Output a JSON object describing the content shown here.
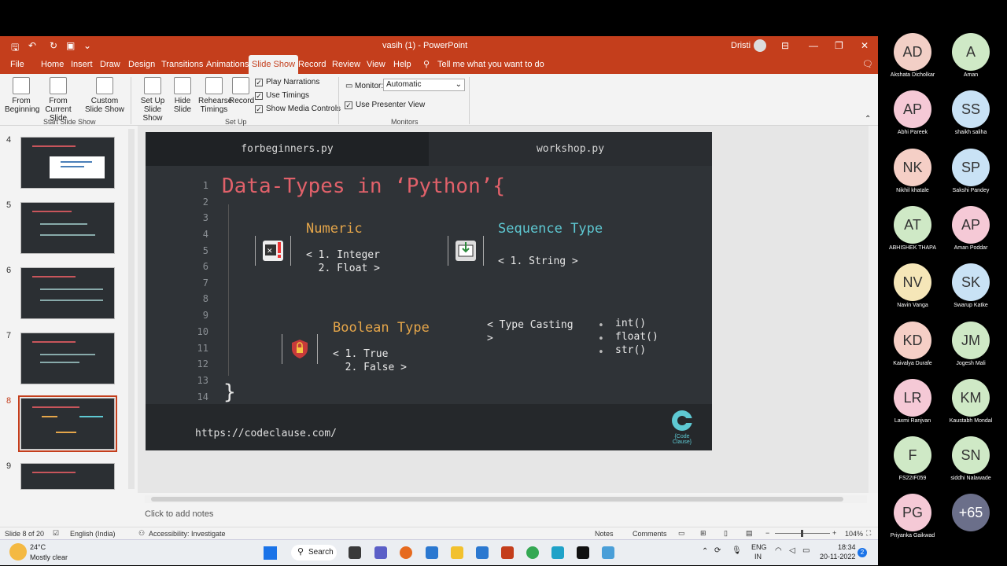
{
  "window": {
    "title": "vasih (1) - PowerPoint",
    "user": "Dristi"
  },
  "menu": [
    "File",
    "Home",
    "Insert",
    "Draw",
    "Design",
    "Transitions",
    "Animations",
    "Slide Show",
    "Record",
    "Review",
    "View",
    "Help",
    "Tell me what you want to do"
  ],
  "ribbon": {
    "from_beginning": "From Beginning",
    "from_current": "From Current Slide",
    "custom_show": "Custom Slide Show",
    "group_start": "Start Slide Show",
    "setup_show": "Set Up Slide Show",
    "hide_slide": "Hide Slide",
    "rehearse": "Rehearse Timings",
    "record": "Record",
    "play_narrations": "Play Narrations",
    "use_timings": "Use Timings",
    "show_media": "Show Media Controls",
    "group_setup": "Set Up",
    "monitor_label": "Monitor:",
    "monitor_value": "Automatic",
    "presenter_view": "Use Presenter View",
    "group_monitors": "Monitors"
  },
  "thumbs": [
    "4",
    "5",
    "6",
    "7",
    "8",
    "9"
  ],
  "slide": {
    "tab_left": "forbeginners.py",
    "tab_right": "workshop.py",
    "title": "Data-Types in ‘Python’{",
    "line_numbers": [
      "1",
      "2",
      "3",
      "4",
      "5",
      "6",
      "7",
      "8",
      "9",
      "10",
      "11",
      "12",
      "13",
      "14"
    ],
    "numeric_heading": "Numeric",
    "numeric_items": "< 1. Integer\n  2. Float >",
    "sequence_heading": "Sequence Type",
    "sequence_items": "< 1. String >",
    "boolean_heading": "Boolean Type",
    "boolean_items": "< 1. True\n  2. False >",
    "casting": "< Type Casting\n>",
    "casting_funcs": "int()\nfloat()\nstr()",
    "close_brace": "}",
    "url": "https://codeclause.com/",
    "logo_text": "{Code Clause}"
  },
  "notes_placeholder": "Click to add notes",
  "status": {
    "slide": "Slide 8 of 20",
    "language": "English (India)",
    "accessibility": "Accessibility: Investigate",
    "notes": "Notes",
    "comments": "Comments",
    "zoom": "104%"
  },
  "taskbar": {
    "temp": "24°C",
    "weather": "Mostly clear",
    "search": "Search",
    "lang1": "ENG",
    "lang2": "IN",
    "time": "18:34",
    "date": "20-11-2022",
    "badge": "2"
  },
  "participants": [
    {
      "initials": "AD",
      "name": "Akshata Dicholkar",
      "color": "#f2cfc6"
    },
    {
      "initials": "A",
      "name": "Aman",
      "color": "#cfe9c6"
    },
    {
      "initials": "AP",
      "name": "Abhi Pareek",
      "color": "#f5c9d6"
    },
    {
      "initials": "SS",
      "name": "shaikh saliha",
      "color": "#c9e2f5"
    },
    {
      "initials": "NK",
      "name": "Nikhil khatale",
      "color": "#f5cfc6"
    },
    {
      "initials": "SP",
      "name": "Sakshi Pandey",
      "color": "#c9e2f5"
    },
    {
      "initials": "AT",
      "name": "ABHISHEK THAPA",
      "color": "#cfe9c6"
    },
    {
      "initials": "AP",
      "name": "Aman Poddar",
      "color": "#f5c9d6"
    },
    {
      "initials": "NV",
      "name": "Navin Vanga",
      "color": "#f5e6b8"
    },
    {
      "initials": "SK",
      "name": "Swarup Katke",
      "color": "#c9e2f5"
    },
    {
      "initials": "KD",
      "name": "Kaivalya Durafe",
      "color": "#f5cfc6"
    },
    {
      "initials": "JM",
      "name": "Jogesh Mali",
      "color": "#cfe9c6"
    },
    {
      "initials": "LR",
      "name": "Laxmi Ranjvan",
      "color": "#f5c9d6"
    },
    {
      "initials": "KM",
      "name": "Kaustabh Mondal",
      "color": "#cfe9c6"
    },
    {
      "initials": "F",
      "name": "FS22IF059",
      "color": "#cfe9c6"
    },
    {
      "initials": "SN",
      "name": "siddhi Nalawade",
      "color": "#cfe9c6"
    },
    {
      "initials": "PG",
      "name": "Priyanka Gaikwad",
      "color": "#f5c9d6"
    },
    {
      "initials": "+65",
      "name": "",
      "color": "#6b6f8a"
    }
  ]
}
